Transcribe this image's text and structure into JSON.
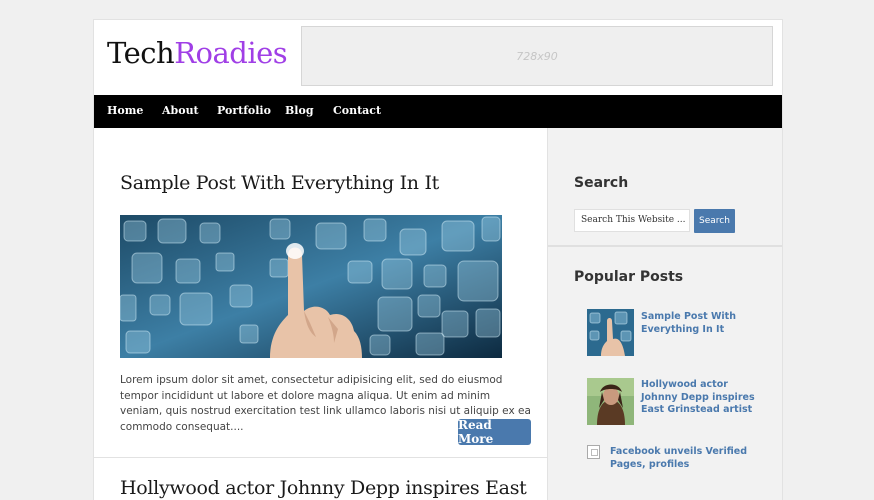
{
  "logo": {
    "part1": "Tech",
    "part2": "Roadies"
  },
  "ad": {
    "label": "728x90"
  },
  "nav": {
    "items": [
      "Home",
      "About",
      "Portfolio",
      "Blog",
      "Contact"
    ]
  },
  "posts": [
    {
      "title": "Sample Post With Everything In It",
      "excerpt": "Lorem ipsum dolor sit amet, consectetur adipisicing elit, sed do eiusmod tempor incididunt ut labore et dolore magna aliqua. Ut enim ad minim veniam, quis nostrud exercitation test link ullamco laboris nisi ut aliquip ex ea commodo consequat....",
      "read_more": "Read More"
    },
    {
      "title": "Hollywood actor Johnny Depp inspires East"
    }
  ],
  "sidebar": {
    "search": {
      "title": "Search",
      "placeholder": "Search This Website ...",
      "button": "Search"
    },
    "popular": {
      "title": "Popular Posts",
      "items": [
        "Sample Post With Everything In It",
        "Hollywood actor Johnny Depp inspires East Grinstead artist",
        "Facebook unveils Verified Pages, profiles"
      ]
    }
  },
  "colors": {
    "accent": "#4a79ad",
    "logo_accent": "#a03fe6",
    "nav_bg": "#000000"
  }
}
